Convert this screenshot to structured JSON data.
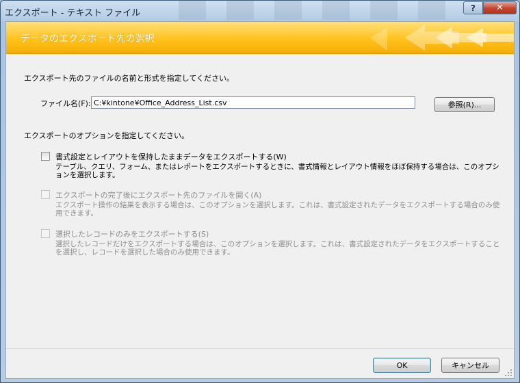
{
  "window": {
    "title": "エクスポート - テキスト ファイル",
    "help_label": "?",
    "close_label": "✕"
  },
  "banner": {
    "title": "データのエクスポート先の選択"
  },
  "instructions": {
    "file_prompt": "エクスポート先のファイルの名前と形式を指定してください。",
    "options_prompt": "エクスポートのオプションを指定してください。"
  },
  "file": {
    "label": "ファイル名(F):",
    "value": "C:¥kintone¥Office_Address_List.csv",
    "browse_label": "参照(R)..."
  },
  "options": [
    {
      "label": "書式設定とレイアウトを保持したままデータをエクスポートする(W)",
      "description": "テーブル、クエリ、フォーム、またはレポートをエクスポートするときに、書式情報とレイアウト情報をほぼ保持する場合は、このオプションを選択します。",
      "checked": false,
      "enabled": true
    },
    {
      "label": "エクスポートの完了後にエクスポート先のファイルを開く(A)",
      "description": "エクスポート操作の結果を表示する場合は、このオプションを選択します。これは、書式設定されたデータをエクスポートする場合のみ使用できます。",
      "checked": false,
      "enabled": false
    },
    {
      "label": "選択したレコードのみをエクスポートする(S)",
      "description": "選択したレコードだけをエクスポートする場合は、このオプションを選択します。これは、書式設定されたデータをエクスポートすることを選択し、レコードを選択した場合のみ使用できます。",
      "checked": false,
      "enabled": false
    }
  ],
  "footer": {
    "ok_label": "OK",
    "cancel_label": "キャンセル"
  },
  "colors": {
    "banner": "#ffc21c",
    "close": "#c2452e"
  }
}
